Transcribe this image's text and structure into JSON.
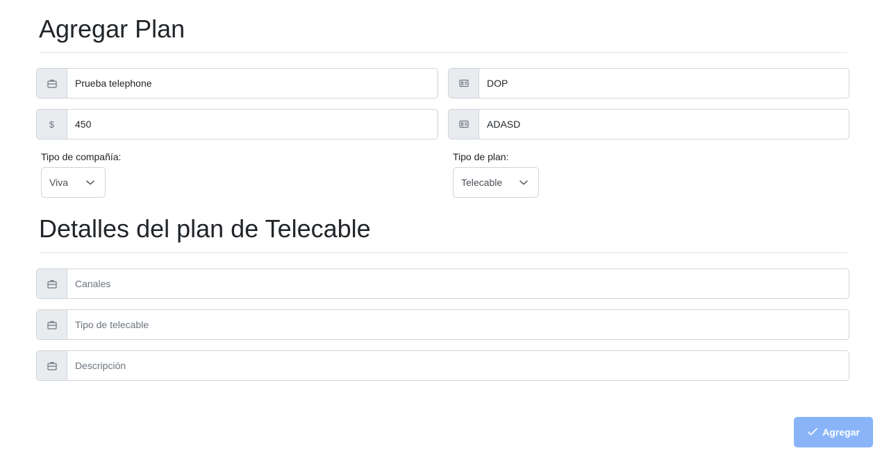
{
  "header": {
    "title": "Agregar Plan"
  },
  "plan_form": {
    "name_value": "Prueba telephone",
    "currency_value": "DOP",
    "price_symbol": "$",
    "price_value": "450",
    "code_value": "ADASD",
    "company_label": "Tipo de compañía:",
    "company_selected": "Viva",
    "plan_type_label": "Tipo de plan:",
    "plan_type_selected": "Telecable"
  },
  "details": {
    "title": "Detalles del plan de Telecable",
    "channels_placeholder": "Canales",
    "telecable_type_placeholder": "Tipo de telecable",
    "description_placeholder": "Descripción"
  },
  "actions": {
    "submit_label": "Agregar"
  },
  "colors": {
    "accent": "#8ab4f8",
    "addon_bg": "#e9ecef",
    "border": "#ced4da"
  },
  "icons": {
    "name_addon": "briefcase-icon",
    "currency_addon": "id-card-icon",
    "code_addon": "id-card-icon",
    "details_addon": "briefcase-icon",
    "submit": "check-icon",
    "select": "chevron-down-icon"
  }
}
